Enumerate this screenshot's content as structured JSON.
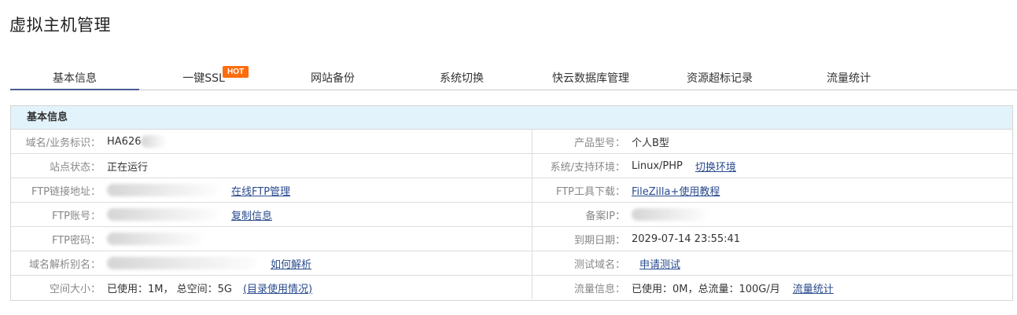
{
  "page": {
    "title": "虚拟主机管理"
  },
  "tabs": [
    {
      "label": "基本信息",
      "active": true
    },
    {
      "label": "一键SSL",
      "badge": "HOT"
    },
    {
      "label": "网站备份"
    },
    {
      "label": "系统切换"
    },
    {
      "label": "快云数据库管理"
    },
    {
      "label": "资源超标记录"
    },
    {
      "label": "流量统计"
    }
  ],
  "panel": {
    "title": "基本信息",
    "rows": [
      {
        "left": {
          "label": "域名/业务标识：",
          "value": "HA626"
        },
        "right": {
          "label": "产品型号：",
          "value": "个人B型"
        }
      },
      {
        "left": {
          "label": "站点状态：",
          "value": "正在运行"
        },
        "right": {
          "label": "系统/支持环境：",
          "value": "Linux/PHP",
          "link": "切换环境"
        }
      },
      {
        "left": {
          "label": "FTP链接地址：",
          "link": "在线FTP管理"
        },
        "right": {
          "label": "FTP工具下载：",
          "link": "FileZilla+使用教程"
        }
      },
      {
        "left": {
          "label": "FTP账号：",
          "link": "复制信息"
        },
        "right": {
          "label": "备案IP："
        }
      },
      {
        "left": {
          "label": "FTP密码："
        },
        "right": {
          "label": "到期日期：",
          "value": "2029-07-14 23:55:41"
        }
      },
      {
        "left": {
          "label": "域名解析别名：",
          "link": "如何解析"
        },
        "right": {
          "label": "测试域名：",
          "link": "申请测试"
        }
      },
      {
        "left": {
          "label": "空间大小：",
          "value": "已使用：1M， 总空间：5G",
          "link": "(目录使用情况)"
        },
        "right": {
          "label": "流量信息：",
          "value": "已使用：0M，总流量：100G/月",
          "link": "流量统计"
        }
      }
    ]
  },
  "colors": {
    "accent": "#4a5c93",
    "hot": "#ff6d0c",
    "panel_header_bg": "#e3f3fb",
    "link": "#2a4b8d"
  }
}
